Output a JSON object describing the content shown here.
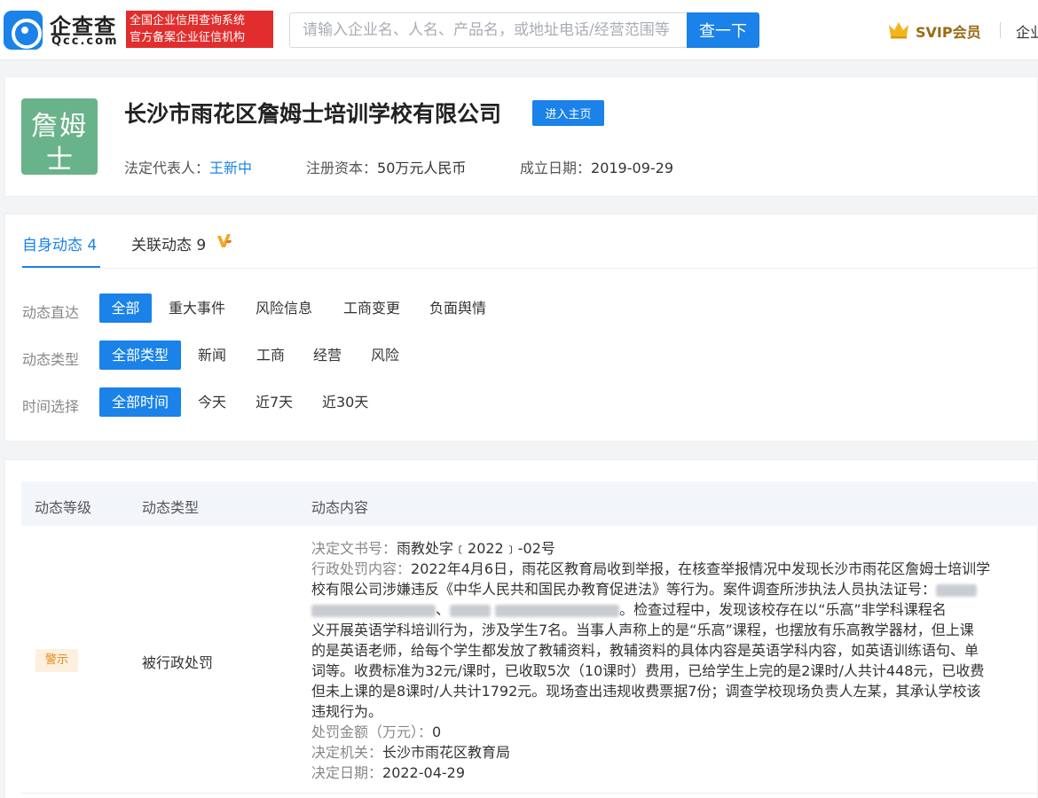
{
  "header": {
    "logo_cn": "企查查",
    "logo_en": "Qcc.com",
    "slogan_line1": "全国企业信用查询系统",
    "slogan_line2": "官方备案企业征信机构",
    "search_placeholder": "请输入企业名、人名、产品名，或地址电话/经营范围等",
    "search_button": "查一下",
    "svip_label": "SVIP会员",
    "nav_enterprise": "企业"
  },
  "company": {
    "logo_line1": "詹姆",
    "logo_line2": "士",
    "name": "长沙市雨花区詹姆士培训学校有限公司",
    "enter_button": "进入主页",
    "legal_rep_label": "法定代表人：",
    "legal_rep_value": "王新中",
    "capital_label": "注册资本：",
    "capital_value": "50万元人民币",
    "founded_label": "成立日期：",
    "founded_value": "2019-09-29"
  },
  "tabs": {
    "self": "自身动态 4",
    "related": "关联动态 9"
  },
  "filters": {
    "row1_label": "动态直达",
    "row1": [
      "全部",
      "重大事件",
      "风险信息",
      "工商变更",
      "负面舆情"
    ],
    "row2_label": "动态类型",
    "row2": [
      "全部类型",
      "新闻",
      "工商",
      "经营",
      "风险"
    ],
    "row3_label": "时间选择",
    "row3": [
      "全部时间",
      "今天",
      "近7天",
      "近30天"
    ]
  },
  "table": {
    "headers": [
      "动态等级",
      "动态类型",
      "动态内容"
    ],
    "row": {
      "level": "警示",
      "type": "被行政处罚",
      "doc_label": "决定文书号：",
      "doc_value": "雨教处字﹝2022﹞-02号",
      "content_label": "行政处罚内容：",
      "content_l1": "2022年4月6日，雨花区教育局收到举报，在核查举报情况中发现长沙市雨花区詹姆士培训学",
      "content_l2": "校有限公司涉嫌违反《中华人民共和国民办教育促进法》等行为。案件调查所涉执法人员执法证号：",
      "content_l3_a": "、",
      "content_l3_b": "。检查过程中，发现该校存在以“乐高”非学科课程名",
      "content_l4": "义开展英语学科培训行为，涉及学生7名。当事人声称上的是“乐高”课程，也摆放有乐高教学器材，但上课",
      "content_l5": "的是英语老师，给每个学生都发放了教辅资料，教辅资料的具体内容是英语学科内容，如英语训练语句、单",
      "content_l6": "词等。收费标准为32元/课时，已收取5次（10课时）费用，已给学生上完的是2课时/人共计448元，已收费",
      "content_l7": "但未上课的是8课时/人共计1792元。现场查出违规收费票据7份；调查学校现场负责人左某，其承认学校该",
      "content_l8": "违规行为。",
      "amount_label": "处罚金额（万元）：",
      "amount_value": "0",
      "authority_label": "决定机关：",
      "authority_value": "长沙市雨花区教育局",
      "date_label": "决定日期：",
      "date_value": "2022-04-29"
    }
  },
  "colors": {
    "primary": "#1a82e8",
    "slogan_red": "#e12d2d",
    "logo_green": "#69b38a",
    "warning_orange": "#e58a1b"
  }
}
